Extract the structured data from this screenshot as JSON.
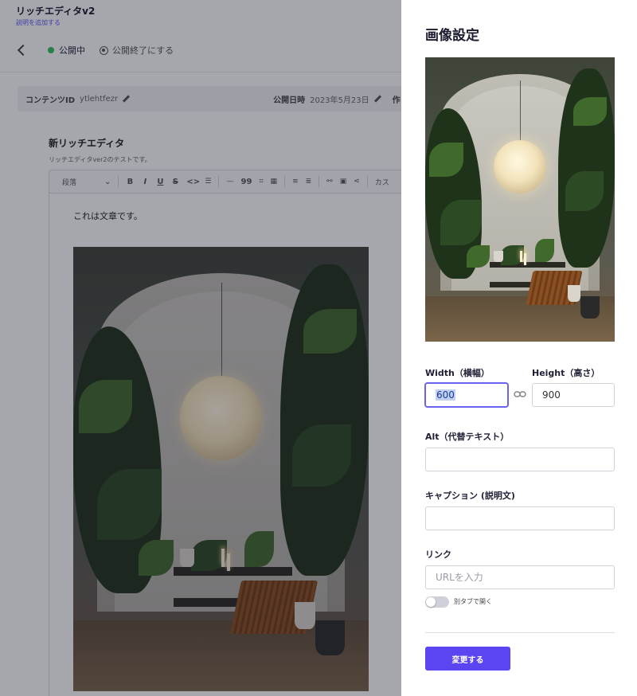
{
  "editor": {
    "title": "リッチエディタv2",
    "subtitle": "説明を追加する",
    "status": "公開中",
    "unpublish_label": "公開終了にする",
    "content_id_label": "コンテンツID",
    "content_id_value": "ytlehtfezr",
    "publish_date_label": "公開日時",
    "publish_date_value": "2023年5月23日",
    "truncated_label": "作",
    "field_title": "新リッチエディタ",
    "field_description": "リッチエディタver2のテストです。",
    "toolbar": {
      "paragraph_select": "段落",
      "bold": "B",
      "italic": "I",
      "underline": "U",
      "strike": "S",
      "code": "<>",
      "quote": "99",
      "truncated_item": "カス"
    },
    "body_text": "これは文章です。",
    "status_color": "#2fc45c"
  },
  "panel": {
    "title": "画像設定",
    "width_label": "Width（横幅）",
    "width_value": "600",
    "height_label": "Height（高さ）",
    "height_value": "900",
    "alt_label": "Alt（代替テキスト）",
    "alt_value": "",
    "caption_label": "キャプション (説明文)",
    "caption_value": "",
    "link_label": "リンク",
    "link_placeholder": "URLを入力",
    "link_value": "",
    "new_tab_label": "別タブで開く",
    "new_tab_enabled": false,
    "save_label": "変更する",
    "accent_color": "#5b45f0"
  }
}
